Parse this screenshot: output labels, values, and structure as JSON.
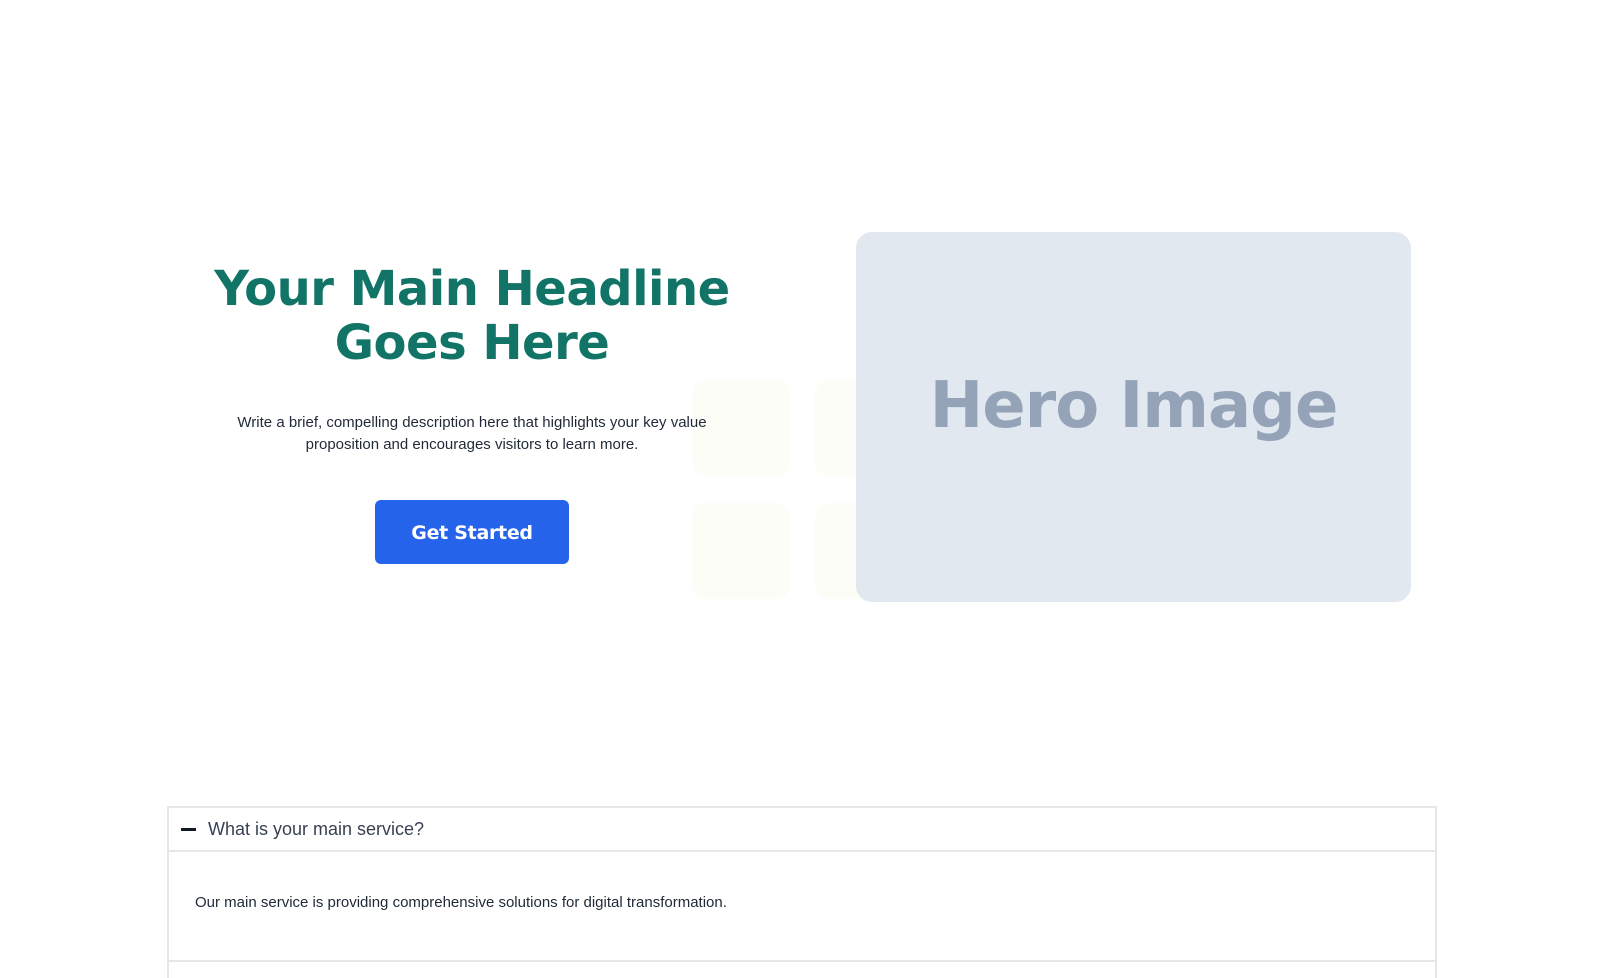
{
  "hero": {
    "headline": "Your Main Headline Goes Here",
    "description": "Write a brief, compelling description here that highlights your key value proposition and encourages visitors to learn more.",
    "cta_label": "Get Started",
    "image_label": "Hero Image"
  },
  "faq": {
    "items": [
      {
        "question": "What is your main service?",
        "answer": "Our main service is providing comprehensive solutions for digital transformation.",
        "expanded": true
      }
    ]
  },
  "colors": {
    "headline": "#117466",
    "cta_background": "#2563eb",
    "image_placeholder": "#e2e8f0",
    "image_label": "#94a3b8"
  }
}
